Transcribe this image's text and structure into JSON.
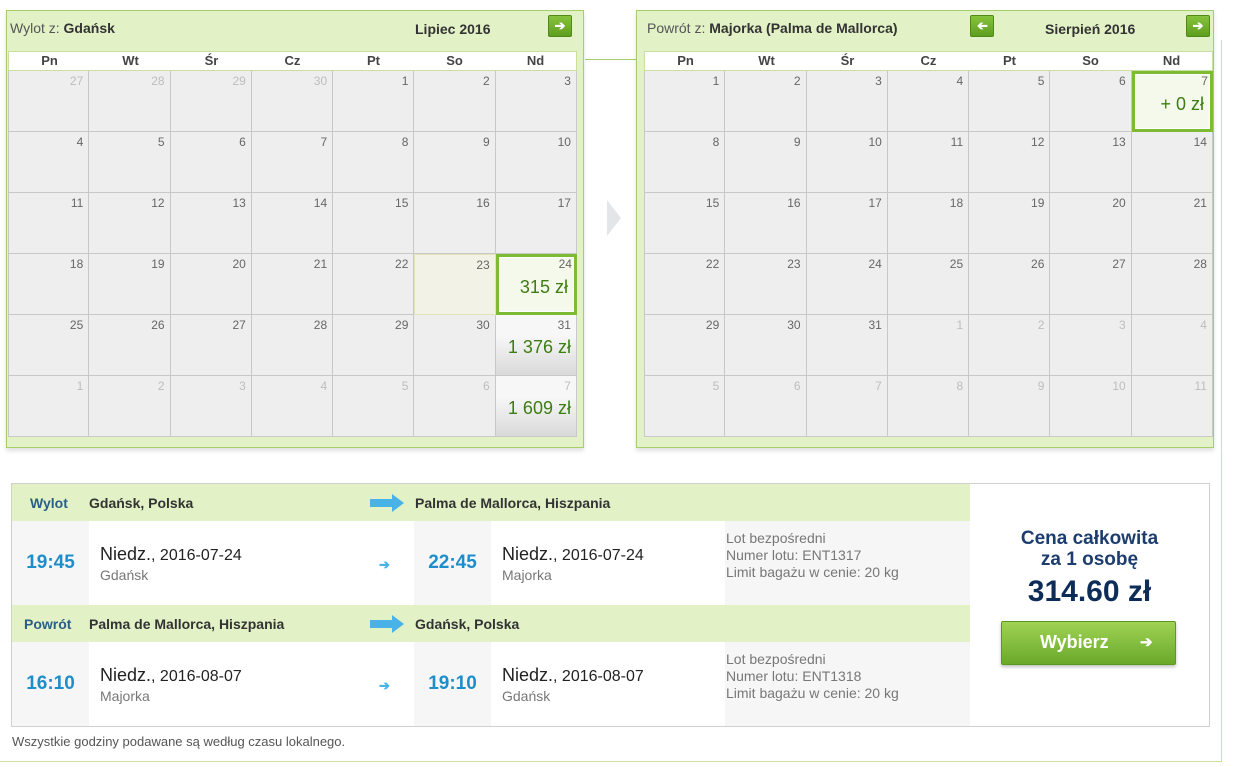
{
  "outbound_calendar": {
    "route_label": "Wylot z:",
    "route_city": "Gdańsk",
    "month": "Lipiec 2016",
    "next_icon": "arrow-right-icon",
    "weekdays": [
      "Pn",
      "Wt",
      "Śr",
      "Cz",
      "Pt",
      "So",
      "Nd"
    ],
    "weeks": [
      [
        {
          "n": "27",
          "m": true
        },
        {
          "n": "28",
          "m": true
        },
        {
          "n": "29",
          "m": true
        },
        {
          "n": "30",
          "m": true
        },
        {
          "n": "1"
        },
        {
          "n": "2"
        },
        {
          "n": "3"
        }
      ],
      [
        {
          "n": "4"
        },
        {
          "n": "5"
        },
        {
          "n": "6"
        },
        {
          "n": "7"
        },
        {
          "n": "8"
        },
        {
          "n": "9"
        },
        {
          "n": "10"
        }
      ],
      [
        {
          "n": "11"
        },
        {
          "n": "12"
        },
        {
          "n": "13"
        },
        {
          "n": "14"
        },
        {
          "n": "15"
        },
        {
          "n": "16"
        },
        {
          "n": "17"
        }
      ],
      [
        {
          "n": "18"
        },
        {
          "n": "19"
        },
        {
          "n": "20"
        },
        {
          "n": "21"
        },
        {
          "n": "22"
        },
        {
          "n": "23",
          "hover": true
        },
        {
          "n": "24",
          "price": "315 zł",
          "selected": true
        }
      ],
      [
        {
          "n": "25"
        },
        {
          "n": "26"
        },
        {
          "n": "27"
        },
        {
          "n": "28"
        },
        {
          "n": "29"
        },
        {
          "n": "30"
        },
        {
          "n": "31",
          "price": "1 376 zł"
        }
      ],
      [
        {
          "n": "1",
          "m": true
        },
        {
          "n": "2",
          "m": true
        },
        {
          "n": "3",
          "m": true
        },
        {
          "n": "4",
          "m": true
        },
        {
          "n": "5",
          "m": true
        },
        {
          "n": "6",
          "m": true
        },
        {
          "n": "7",
          "m": true,
          "price": "1 609 zł"
        }
      ]
    ]
  },
  "return_calendar": {
    "route_label": "Powrót z:",
    "route_city": "Majorka (Palma de Mallorca)",
    "month": "Sierpień 2016",
    "prev_icon": "arrow-left-icon",
    "next_icon": "arrow-right-icon",
    "weekdays": [
      "Pn",
      "Wt",
      "Śr",
      "Cz",
      "Pt",
      "So",
      "Nd"
    ],
    "weeks": [
      [
        {
          "n": "1"
        },
        {
          "n": "2"
        },
        {
          "n": "3"
        },
        {
          "n": "4"
        },
        {
          "n": "5"
        },
        {
          "n": "6"
        },
        {
          "n": "7",
          "price": "+ 0 zł",
          "selected": true
        }
      ],
      [
        {
          "n": "8"
        },
        {
          "n": "9"
        },
        {
          "n": "10"
        },
        {
          "n": "11"
        },
        {
          "n": "12"
        },
        {
          "n": "13"
        },
        {
          "n": "14"
        }
      ],
      [
        {
          "n": "15"
        },
        {
          "n": "16"
        },
        {
          "n": "17"
        },
        {
          "n": "18"
        },
        {
          "n": "19"
        },
        {
          "n": "20"
        },
        {
          "n": "21"
        }
      ],
      [
        {
          "n": "22"
        },
        {
          "n": "23"
        },
        {
          "n": "24"
        },
        {
          "n": "25"
        },
        {
          "n": "26"
        },
        {
          "n": "27"
        },
        {
          "n": "28"
        }
      ],
      [
        {
          "n": "29"
        },
        {
          "n": "30"
        },
        {
          "n": "31"
        },
        {
          "n": "1",
          "m": true
        },
        {
          "n": "2",
          "m": true
        },
        {
          "n": "3",
          "m": true
        },
        {
          "n": "4",
          "m": true
        }
      ],
      [
        {
          "n": "5",
          "m": true
        },
        {
          "n": "6",
          "m": true
        },
        {
          "n": "7",
          "m": true
        },
        {
          "n": "8",
          "m": true
        },
        {
          "n": "9",
          "m": true
        },
        {
          "n": "10",
          "m": true
        },
        {
          "n": "11",
          "m": true
        }
      ]
    ]
  },
  "outbound": {
    "label": "Wylot",
    "from": "Gdańsk, Polska",
    "to": "Palma de Mallorca, Hiszpania",
    "dep_time": "19:45",
    "dep_day": "Niedz.",
    "dep_date": ", 2016-07-24",
    "dep_city": "Gdańsk",
    "arr_time": "22:45",
    "arr_day": "Niedz.",
    "arr_date": ", 2016-07-24",
    "arr_city": "Majorka",
    "info_direct": "Lot bezpośredni",
    "info_flight": "Numer lotu: ENT1317",
    "info_baggage": "Limit bagażu w cenie: 20 kg"
  },
  "return": {
    "label": "Powrót",
    "from": "Palma de Mallorca, Hiszpania",
    "to": "Gdańsk, Polska",
    "dep_time": "16:10",
    "dep_day": "Niedz.",
    "dep_date": ", 2016-08-07",
    "dep_city": "Majorka",
    "arr_time": "19:10",
    "arr_day": "Niedz.",
    "arr_date": ", 2016-08-07",
    "arr_city": "Gdańsk",
    "info_direct": "Lot bezpośredni",
    "info_flight": "Numer lotu: ENT1318",
    "info_baggage": "Limit bagażu w cenie: 20 kg"
  },
  "total": {
    "line1": "Cena całkowita",
    "line2": "za 1 osobę",
    "amount": "314.60 zł",
    "button": "Wybierz",
    "button_icon": "arrow-right-icon"
  },
  "footnote": "Wszystkie godziny podawane są według czasu lokalnego.",
  "colors": {
    "accent_green": "#7cbb32",
    "price_green": "#3e7d12",
    "time_blue": "#1e8ecb",
    "total_navy": "#0d2c58"
  }
}
